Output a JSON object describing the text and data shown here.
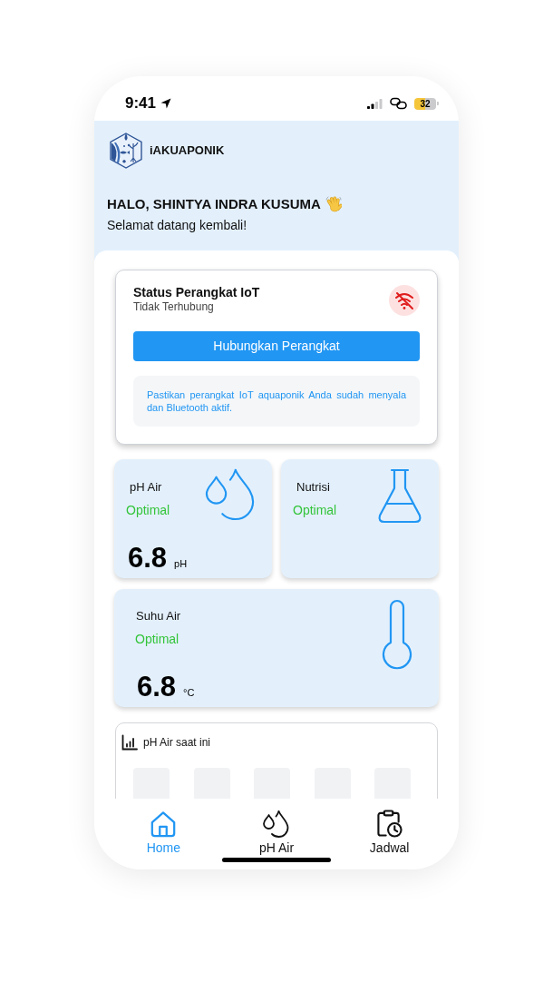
{
  "status_bar": {
    "time": "9:41",
    "battery": "32"
  },
  "header": {
    "app_name": "iAKUAPONIK",
    "greeting": "HALO, SHINTYA INDRA KUSUMA",
    "subtitle": "Selamat datang kembali!"
  },
  "device_status": {
    "title": "Status Perangkat IoT",
    "status": "Tidak Terhubung",
    "connected": false,
    "button": "Hubungkan Perangkat",
    "note": "Pastikan perangkat IoT aquaponik Anda sudah menyala dan Bluetooth aktif."
  },
  "sensors": [
    {
      "kind": "ph",
      "label": "pH Air",
      "status": "Optimal",
      "value": "6.8",
      "unit": "pH"
    },
    {
      "kind": "nutrient",
      "label": "Nutrisi",
      "status": "Optimal"
    },
    {
      "kind": "temperature",
      "label": "Suhu Air",
      "status": "Optimal",
      "value": "6.8",
      "unit": "°C"
    }
  ],
  "chart_card": {
    "title": "pH Air saat ini",
    "loading": true
  },
  "bottom_nav": [
    {
      "kind": "home",
      "label": "Home",
      "selected": true
    },
    {
      "kind": "drops",
      "label": "pH Air",
      "selected": false
    },
    {
      "kind": "schedule",
      "label": "Jadwal",
      "selected": false
    }
  ]
}
